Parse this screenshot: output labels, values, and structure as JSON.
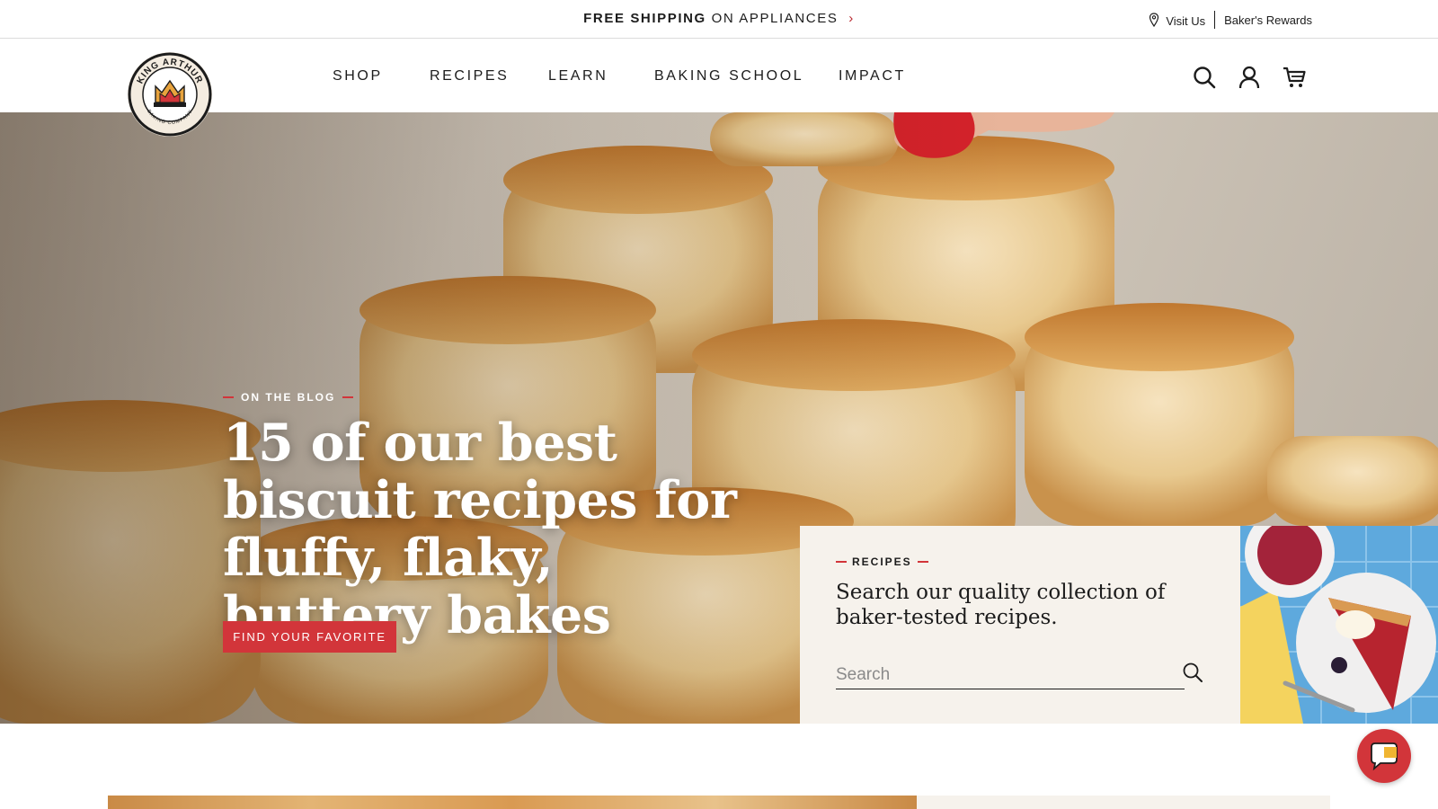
{
  "topbar": {
    "promo_strong": "FREE SHIPPING",
    "promo_rest": "ON APPLIANCES",
    "promo_chevron": "›",
    "visit_us": "Visit Us",
    "rewards": "Baker's Rewards"
  },
  "brand": {
    "logo_icon": "king-arthur-crown-logo",
    "logo_text_top": "KING ARTHUR",
    "logo_text_bottom": "BAKING COMPANY",
    "red": "#d2353a"
  },
  "nav": {
    "items": [
      "SHOP",
      "RECIPES",
      "LEARN",
      "BAKING SCHOOL",
      "IMPACT"
    ]
  },
  "header_icons": [
    "search-icon",
    "account-icon",
    "cart-icon"
  ],
  "hero": {
    "eyebrow": "ON THE BLOG",
    "headline": "15 of our best biscuit recipes for fluffy, flaky, buttery bakes",
    "cta": "FIND YOUR FAVORITE"
  },
  "recipes_card": {
    "label": "RECIPES",
    "text": "Search our quality collection of baker-tested recipes.",
    "search_placeholder": "Search"
  },
  "chat": {
    "icon": "chat-bubble-icon"
  }
}
